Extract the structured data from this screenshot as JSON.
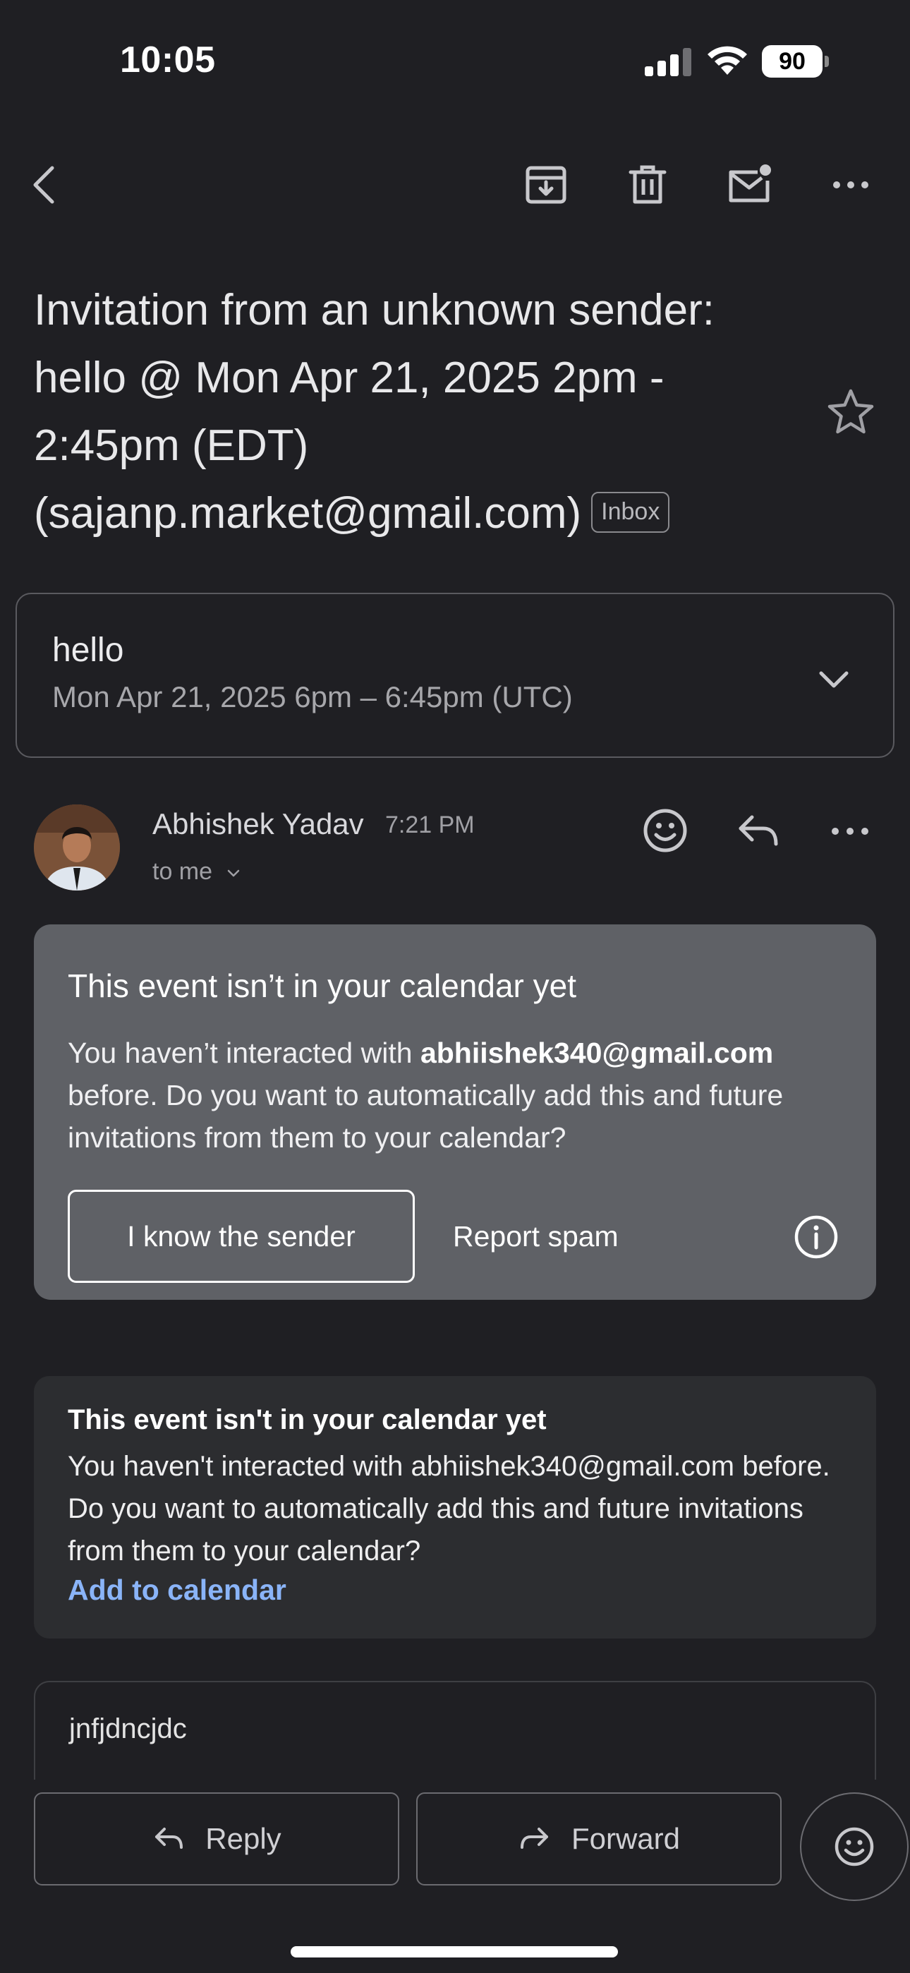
{
  "status_bar": {
    "time": "10:05",
    "battery": "90"
  },
  "toolbar": {
    "back_icon": "chevron-left-icon",
    "archive_icon": "archive-icon",
    "delete_icon": "trash-icon",
    "unread_icon": "mark-unread-icon",
    "more_icon": "more-horizontal-icon"
  },
  "email": {
    "subject": "Invitation from an unknown sender: hello @ Mon Apr 21, 2025 2pm - 2:45pm (EDT) (sajanp.market@gmail.com)",
    "label": "Inbox",
    "starred": false
  },
  "event": {
    "title": "hello",
    "time": "Mon Apr 21, 2025 6pm – 6:45pm (UTC)"
  },
  "sender": {
    "name": "Abhishek Yadav",
    "time": "7:21 PM",
    "recipient": "to me"
  },
  "banner": {
    "title": "This event isn’t in your calendar yet",
    "body_prefix": "You haven’t interacted with ",
    "email": "abhiishek340@gmail.com",
    "body_suffix": " before. Do you want to automatically add this and future invitations from them to your calendar?",
    "know_sender": "I know the sender",
    "report_spam": "Report spam",
    "bg_color": "#5f6166"
  },
  "content_banner": {
    "title": "This event isn't in your calendar yet",
    "body": "You haven't interacted with abhiishek340@gmail.com before. Do you want to automatically add this and future invitations from them to your calendar?",
    "link": "Add to calendar",
    "link_color": "#8ab4f8"
  },
  "message": {
    "text": "jnfjdncjdc"
  },
  "bottom_bar": {
    "reply": "Reply",
    "forward": "Forward"
  }
}
